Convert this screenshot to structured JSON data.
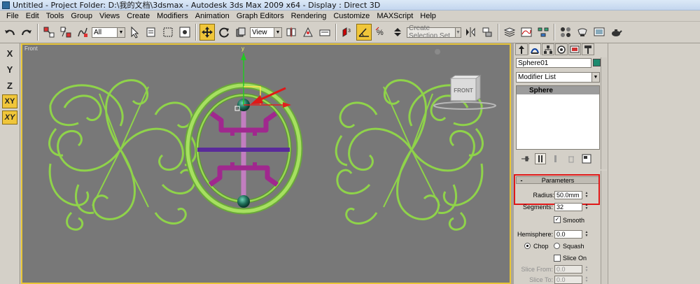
{
  "window": {
    "title": "Untitled    - Project Folder: D:\\我的文档\\3dsmax    - Autodesk 3ds Max  2009 x64    - Display : Direct 3D"
  },
  "menu": [
    "File",
    "Edit",
    "Tools",
    "Group",
    "Views",
    "Create",
    "Modifiers",
    "Animation",
    "Graph Editors",
    "Rendering",
    "Customize",
    "MAXScript",
    "Help"
  ],
  "toolbar": {
    "selection_filter": "All",
    "reference_coord": "View",
    "named_selection_placeholder": "Create Selection Set"
  },
  "axis_constraints": [
    "X",
    "Y",
    "Z",
    "XY",
    "XY"
  ],
  "viewport": {
    "label": "Front",
    "viewcube_label": "FRONT",
    "gizmo_y": "y"
  },
  "command_panel": {
    "object_name": "Sphere01",
    "object_color": "#1d8a6e",
    "modifier_list": "Modifier List",
    "stack_item": "Sphere",
    "parameters": {
      "title": "Parameters",
      "radius_label": "Radius:",
      "radius_value": "50.0mm",
      "segments_label": "Segments:",
      "segments_value": "32",
      "smooth_label": "Smooth",
      "hemisphere_label": "Hemisphere:",
      "hemisphere_value": "0.0",
      "chop_label": "Chop",
      "squash_label": "Squash",
      "slice_on_label": "Slice On",
      "slice_from_label": "Slice From:",
      "slice_from_value": "0.0",
      "slice_to_label": "Slice To:",
      "slice_to_value": "0.0"
    }
  },
  "colors": {
    "accent_active": "#f0c63a",
    "highlight_box": "#e01818",
    "ornament_green": "#8fd34a",
    "shape_purple": "#a0288e",
    "sphere_teal": "#1f6f5a"
  }
}
